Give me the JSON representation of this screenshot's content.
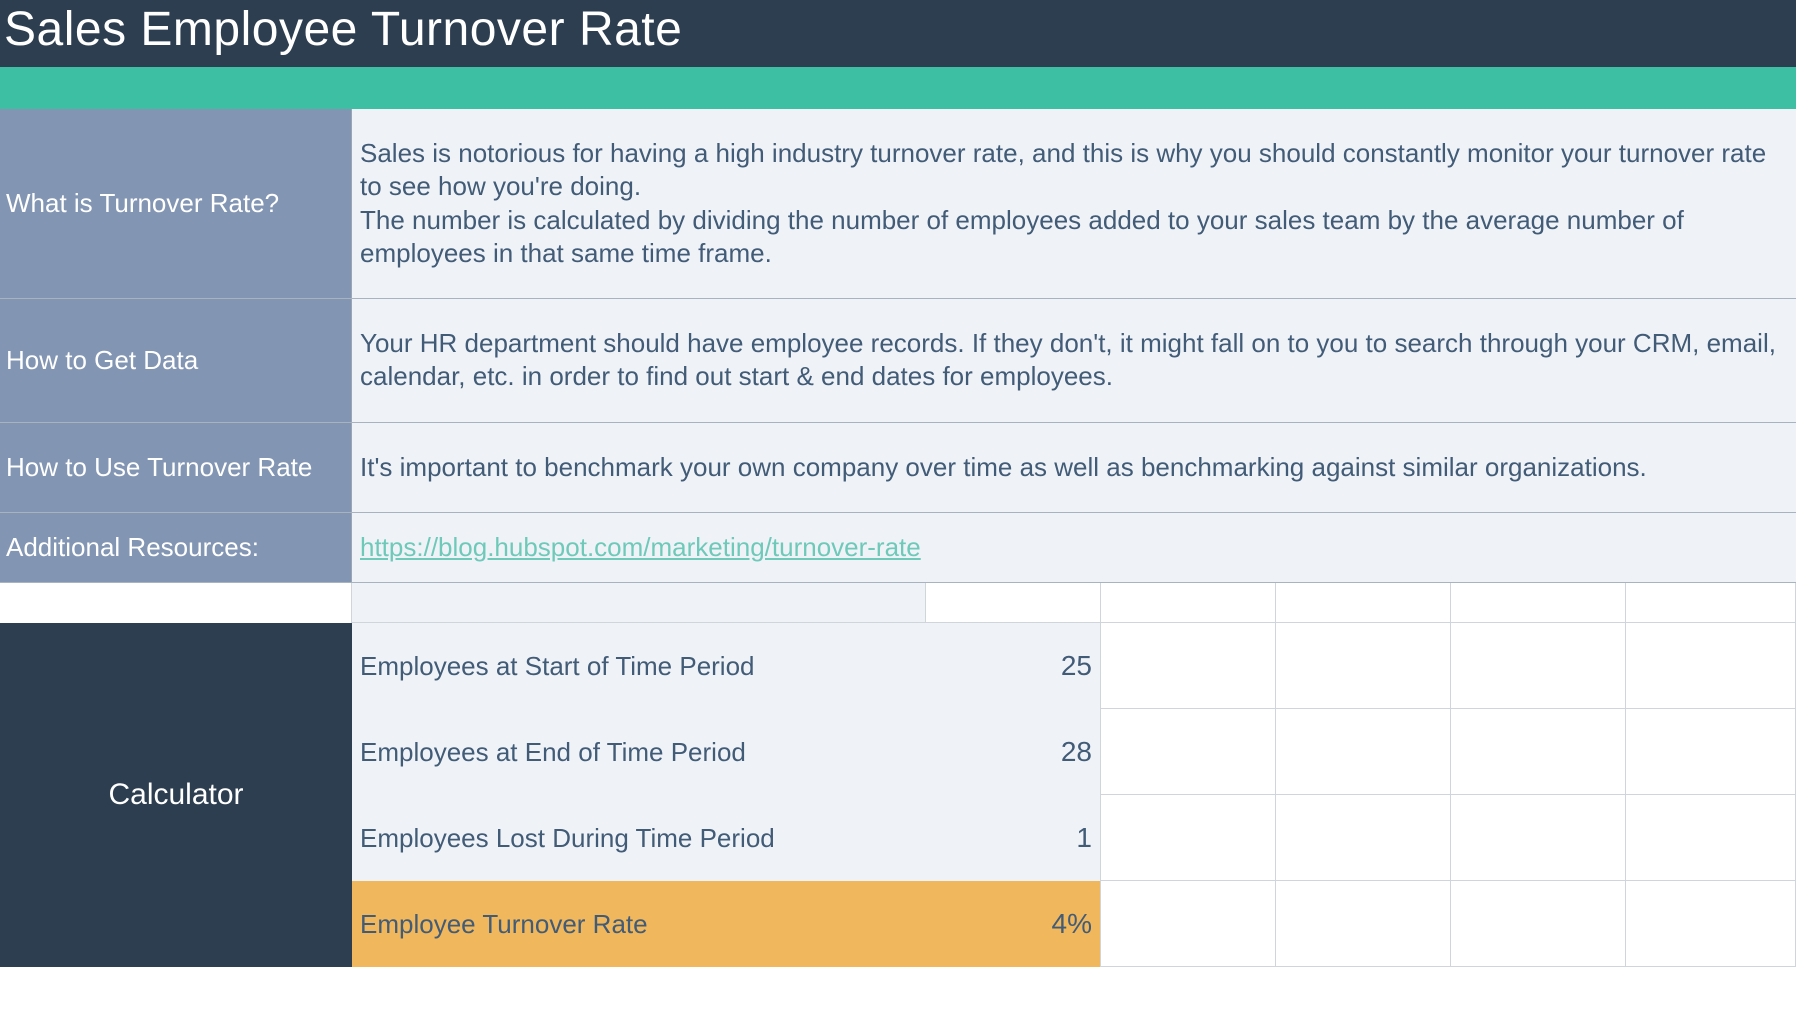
{
  "title": "Sales Employee Turnover Rate",
  "info": [
    {
      "label": "What is Turnover Rate?",
      "text": "Sales is notorious for having a high industry turnover rate, and this is why you should constantly monitor your turnover rate to see how you're doing.\nThe number is calculated by dividing the number of employees added to your sales team by the average number of employees in that same time frame."
    },
    {
      "label": "How to Get Data",
      "text": "Your HR department should have employee records. If they don't, it might fall on to you to search through your CRM, email, calendar, etc. in order to find out start & end dates for employees."
    },
    {
      "label": "How to Use Turnover Rate",
      "text": "It's important to benchmark your own company over time as well as benchmarking against similar organizations."
    },
    {
      "label": "Additional Resources:",
      "link": "https://blog.hubspot.com/marketing/turnover-rate"
    }
  ],
  "calculator": {
    "title": "Calculator",
    "rows": [
      {
        "label": "Employees at Start of Time Period",
        "value": "25"
      },
      {
        "label": "Employees at End of Time Period",
        "value": "28"
      },
      {
        "label": "Employees Lost During Time Period",
        "value": "1"
      }
    ],
    "result": {
      "label": "Employee Turnover Rate",
      "value": "4%"
    }
  }
}
